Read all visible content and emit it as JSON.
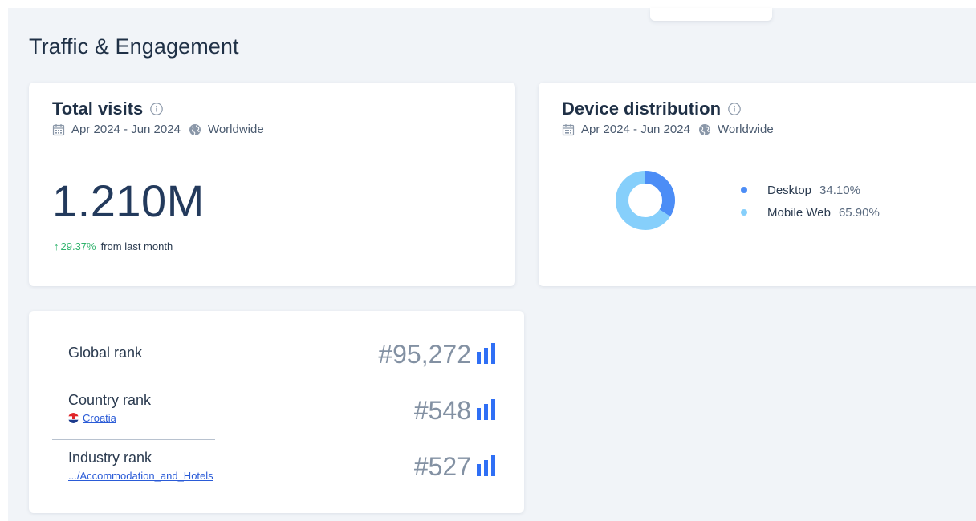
{
  "section": {
    "title": "Traffic & Engagement"
  },
  "total_visits": {
    "title": "Total visits",
    "date_range": "Apr 2024 - Jun 2024",
    "region": "Worldwide",
    "value": "1.210M",
    "change_arrow": "↑",
    "change_percent": "29.37%",
    "change_suffix": "from last month"
  },
  "device_distribution": {
    "title": "Device distribution",
    "date_range": "Apr 2024 - Jun 2024",
    "region": "Worldwide",
    "items": [
      {
        "label": "Desktop",
        "value": "34.10%",
        "color": "#4c8df6"
      },
      {
        "label": "Mobile Web",
        "value": "65.90%",
        "color": "#86cffb"
      }
    ]
  },
  "ranks": {
    "global": {
      "label": "Global rank",
      "value": "#95,272"
    },
    "country": {
      "label": "Country rank",
      "country": "Croatia",
      "value": "#548"
    },
    "industry": {
      "label": "Industry rank",
      "category": ".../Accommodation_and_Hotels",
      "value": "#527"
    }
  },
  "colors": {
    "accent": "#2a5bd7",
    "positive": "#2fb36c",
    "bars": "#2f6ff5"
  },
  "icons": [
    "info-icon",
    "calendar-icon",
    "globe-icon",
    "rank-bars-icon",
    "croatia-flag-icon"
  ]
}
